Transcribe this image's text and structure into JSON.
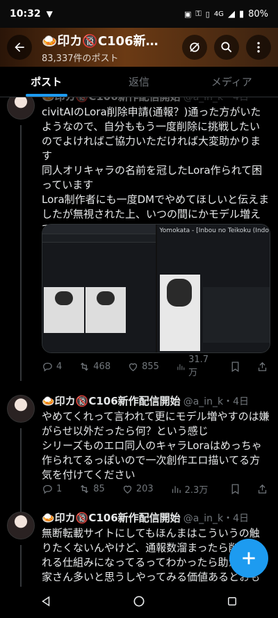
{
  "status": {
    "time": "10:32",
    "network": "4G",
    "battery": "80%"
  },
  "header": {
    "title": "🍛印カ🔞C106新…",
    "subtitle": "83,337件のポスト"
  },
  "tabs": [
    "ポスト",
    "返信",
    "メディア"
  ],
  "tweets": [
    {
      "name": "🍛印カ🔞C106新作配信開始",
      "handle": "@a_in_k・4日",
      "lines": [
        "civitAIのLora削除申請(通報？)通った方がいたようなので、自分ももう一度削除に挑戦したいのでよければご協力いただければ大変助かります",
        "同人オリキャラの名前を冠したLora作られて困っています",
        "Lora制作者にも一度DMでやめてほしいと伝えましたが無視された上、いつの間にかモデル増えてました"
      ],
      "media_caption": "Yomokata - [Inbou no Teikoku (Indo Curry)] Chu (印度カリー)] 猫子)",
      "stats": {
        "replies": "4",
        "reposts": "468",
        "likes": "855",
        "views": "31.7万"
      }
    },
    {
      "name": "🍛印カ🔞C106新作配信開始",
      "handle": "@a_in_k・4日",
      "lines": [
        "やめてくれって言われて更にモデル増やすのは嫌がらせ以外だったら何？という感じ",
        "シリーズものエロ同人のキャラLoraはめっちゃ作られてるっぽいので一次創作エロ描いてる方気を付けてください"
      ],
      "stats": {
        "replies": "1",
        "reposts": "85",
        "likes": "203",
        "views": "2.3万"
      }
    },
    {
      "name": "🍛印カ🔞C106新作配信開始",
      "handle": "@a_in_k・4日",
      "lines": [
        "無断転載サイトにしてもほんまはこういうの触りたくないんやけど、通報数溜まったら削除される仕組みになってるってわかったら助かる作家さん多いと思うしやってみる価値あるとおもったんで晒します"
      ]
    }
  ],
  "colors": {
    "accent": "#1d9bf0",
    "bg": "#000000",
    "muted": "#71767b"
  },
  "icons": [
    "back-arrow-icon",
    "no-sync-icon",
    "search-icon",
    "more-vert-icon",
    "reply-icon",
    "repost-icon",
    "like-icon",
    "views-icon",
    "bookmark-icon",
    "share-icon",
    "compose-plus-icon",
    "nav-back-icon",
    "nav-home-icon",
    "nav-recents-icon"
  ]
}
